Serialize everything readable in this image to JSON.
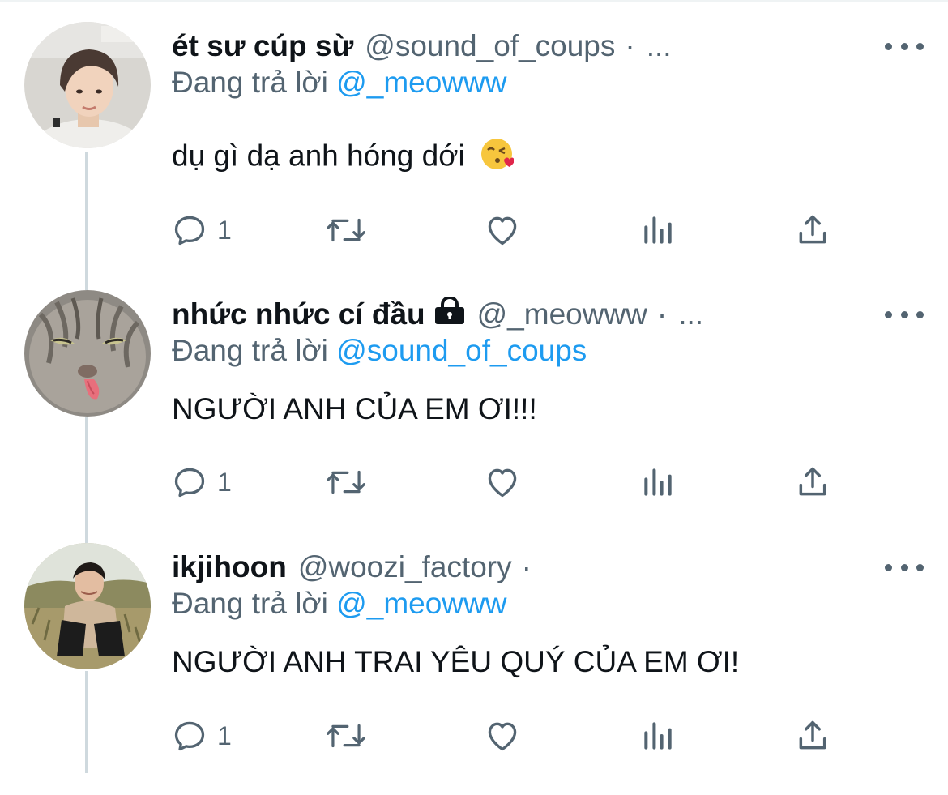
{
  "tweets": [
    {
      "display_name": "ét sư cúp sừ",
      "handle": "@sound_of_coups",
      "separator": "·",
      "ellipsis": "...",
      "locked": false,
      "replying_label": "Đang trả lời",
      "replying_to": "@_meowww",
      "text": "dụ gì dạ anh hóng dới",
      "emoji": "face-blowing-a-kiss",
      "reply_count": "1",
      "avatar": "photo-young-man-white-shirt"
    },
    {
      "display_name": "nhức nhức cí đầu",
      "handle": "@_meowww",
      "separator": "·",
      "ellipsis": "...",
      "locked": true,
      "replying_label": "Đang trả lời",
      "replying_to": "@sound_of_coups",
      "text": "NGƯỜI ANH CỦA EM ƠI!!!",
      "reply_count": "1",
      "avatar": "photo-tabby-cat-tongue"
    },
    {
      "display_name": "ikjihoon",
      "handle": "@woozi_factory",
      "separator": "·",
      "ellipsis": "",
      "locked": false,
      "replying_label": "Đang trả lời",
      "replying_to": "@_meowww",
      "text": "NGƯỜI ANH TRAI YÊU QUÝ CỦA EM ƠI!",
      "reply_count": "1",
      "avatar": "photo-man-in-field"
    }
  ],
  "icons": {
    "reply": "reply-icon",
    "retweet": "retweet-icon",
    "like": "heart-icon",
    "views": "views-icon",
    "share": "share-icon",
    "more": "more-icon",
    "lock": "lock-icon"
  },
  "colors": {
    "primary_text": "#0f1419",
    "secondary_text": "#536471",
    "link": "#1d9bf0",
    "thread_line": "#cfd9de"
  }
}
